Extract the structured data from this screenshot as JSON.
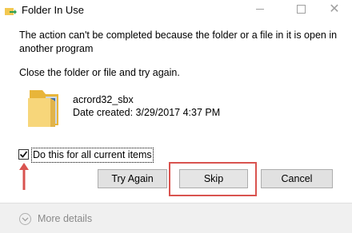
{
  "window": {
    "title": "Folder In Use",
    "icons": {
      "app": "folder-move-icon",
      "minimize": "minimize-icon",
      "maximize": "maximize-icon",
      "close": "close-icon"
    }
  },
  "dialog": {
    "message": "The action can't be completed because the folder or a file in it is open in another program",
    "instruction": "Close the folder or file and try again.",
    "file": {
      "name": "acrord32_sbx",
      "date_created": "Date created: 3/29/2017 4:37 PM",
      "icon": "folder-icon"
    },
    "checkbox": {
      "label": "Do this for all current items",
      "checked": true
    },
    "buttons": {
      "try_again": "Try Again",
      "skip": "Skip",
      "cancel": "Cancel"
    },
    "annotation": {
      "arrow_color": "#d9534f",
      "highlight_color": "#d9534f",
      "highlight_target": "Skip"
    }
  },
  "footer": {
    "more_details": "More details",
    "icon": "chevron-down-icon"
  },
  "colors": {
    "button_bg": "#e1e1e1",
    "footer_bg": "#f0f0f0",
    "annotation_red": "#d9534f"
  }
}
